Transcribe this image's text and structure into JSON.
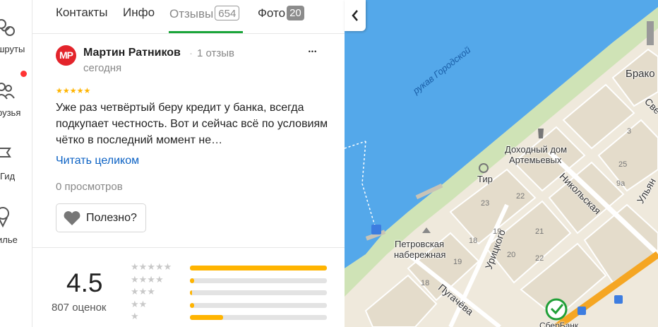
{
  "sidebar": {
    "items": [
      {
        "label": "шруты",
        "icon": "routes-icon"
      },
      {
        "label": "рузья",
        "icon": "friends-icon"
      },
      {
        "label": "Гид",
        "icon": "guide-icon"
      },
      {
        "label": "илье",
        "icon": "housing-icon"
      }
    ]
  },
  "tabs": [
    {
      "label": "Контакты"
    },
    {
      "label": "Инфо"
    },
    {
      "label": "Отзывы",
      "count": "654"
    },
    {
      "label": "Фото",
      "count": "20"
    }
  ],
  "review": {
    "avatar_initials": "MP",
    "author": "Мартин Ратников",
    "author_reviews": "1 отзыв",
    "date": "сегодня",
    "more": "•••",
    "stars": "★★★★★",
    "rating": 5,
    "text": "Уже раз четвёртый беру кредит у банка, всегда подкупает честность. Вот и сейчас всё по условиям чётко в последний момент не…",
    "read_more": "Читать целиком",
    "views": "0 просмотров",
    "useful_label": "Полезно?"
  },
  "summary": {
    "rating": "4.5",
    "count": "807 оценок",
    "distribution": [
      {
        "stars": "★★★★★",
        "fraction": 1.0
      },
      {
        "stars": "★★★★",
        "fraction": 0.03
      },
      {
        "stars": "★★★",
        "fraction": 0.015
      },
      {
        "stars": "★★",
        "fraction": 0.03
      },
      {
        "stars": "★",
        "fraction": 0.24
      }
    ]
  },
  "map": {
    "labels": {
      "river": "рукав Городской",
      "brako": "Брако",
      "sve": "Све",
      "dom1": "Доходный дом",
      "dom2": "Артемьевых",
      "tir": "Тир",
      "nikolskaya": "Никольская",
      "ulyan": "Ульян",
      "naber1": "Петровская",
      "naber2": "набережная",
      "tritskogo": "Урицкого",
      "pugacheva": "Пугачёва",
      "sberbank": "СберБанк"
    },
    "numbers": [
      "23",
      "22",
      "25",
      "9а",
      "18",
      "19",
      "20",
      "21",
      "22",
      "18",
      "19",
      "3"
    ]
  },
  "colors": {
    "water": "#54a8ea",
    "accent_green": "#1ba53a",
    "star_yellow": "#ffb400",
    "link_blue": "#0c62c4",
    "avatar_red": "#e3242b"
  }
}
